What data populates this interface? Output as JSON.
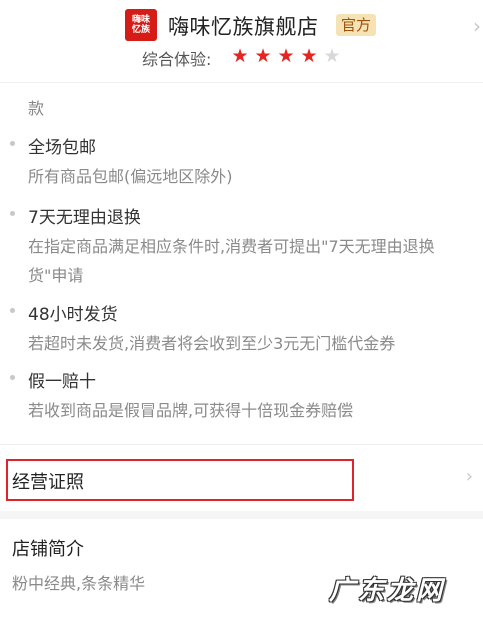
{
  "header": {
    "logo_text_line1": "嗨味",
    "logo_text_line2": "忆族",
    "shop_name": "嗨味忆族旗舰店",
    "badge": "官方",
    "rating_label": "综合体验:",
    "rating": {
      "value": 4,
      "max": 5
    },
    "star_color": "#e52521"
  },
  "partial_text": "款",
  "services": [
    {
      "title": "全场包邮",
      "desc": "所有商品包邮(偏远地区除外)"
    },
    {
      "title": "7天无理由退换",
      "desc": "在指定商品满足相应条件时,消费者可提出\"7天无理由退换货\"申请"
    },
    {
      "title": "48小时发货",
      "desc": "若超时未发货,消费者将会收到至少3元无门槛代金券"
    },
    {
      "title": "假一赔十",
      "desc": "若收到商品是假冒品牌,可获得十倍现金券赔偿"
    }
  ],
  "license": {
    "label": "经营证照",
    "highlight_color": "#e0232b"
  },
  "intro": {
    "title": "店铺简介",
    "desc": "粉中经典,条条精华"
  },
  "watermark": "广东龙网"
}
